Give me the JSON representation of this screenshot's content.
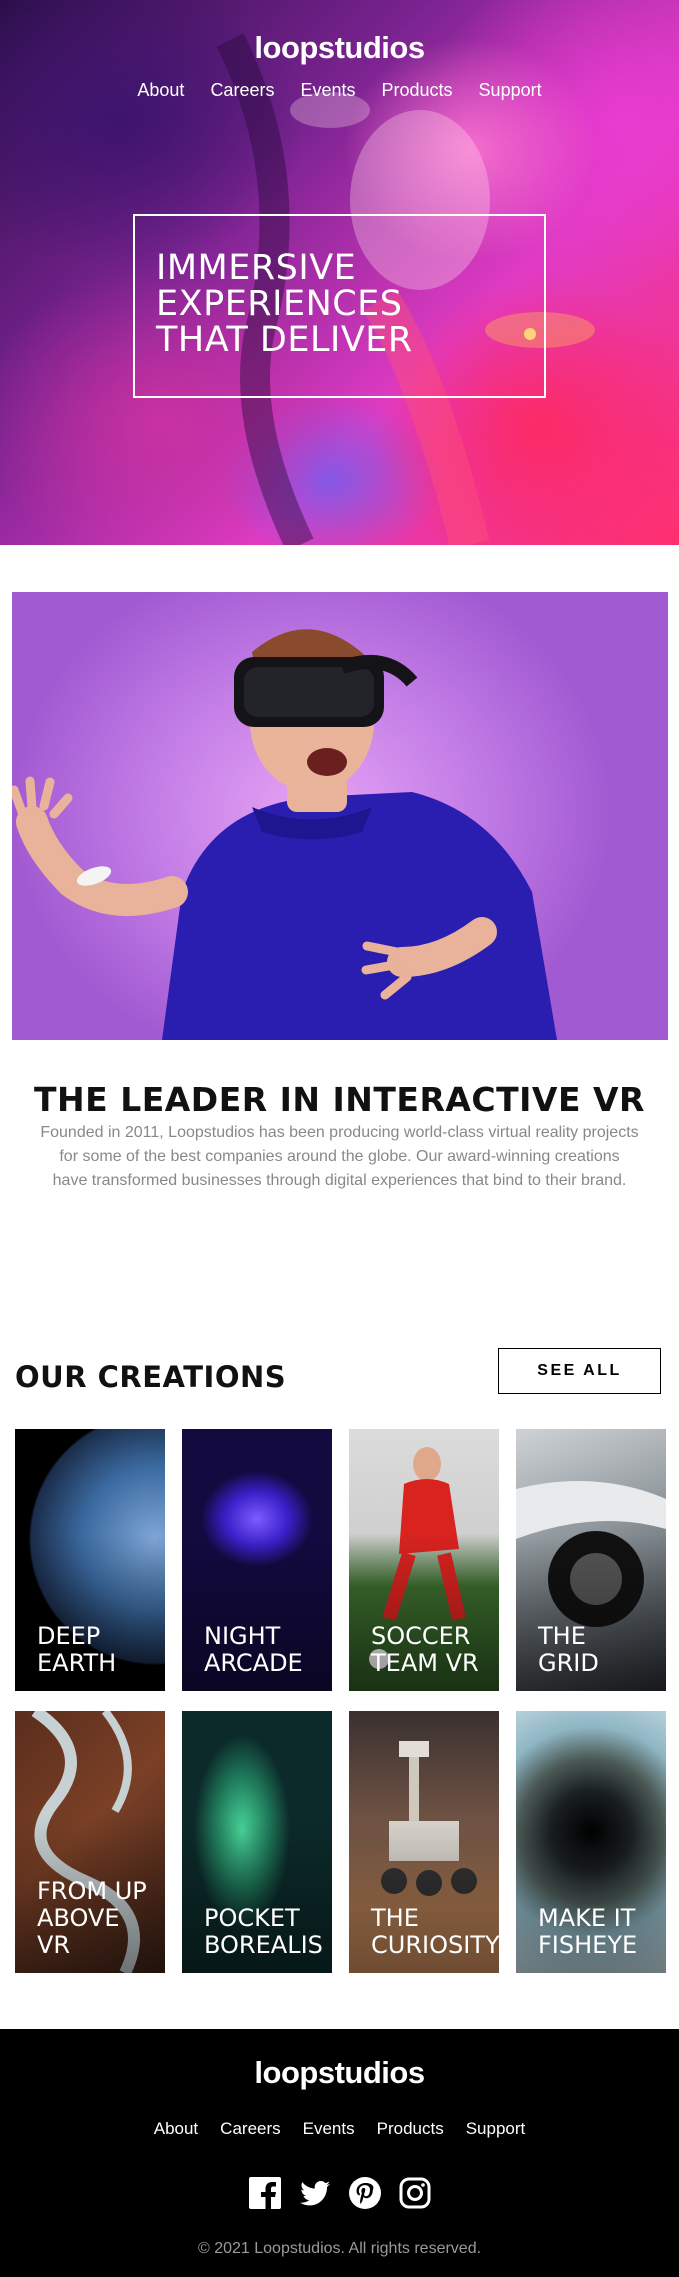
{
  "brand": {
    "name": "loopstudios"
  },
  "nav": [
    "About",
    "Careers",
    "Events",
    "Products",
    "Support"
  ],
  "hero": {
    "title_lines": [
      "IMMERSIVE",
      "EXPERIENCES",
      "THAT DELIVER"
    ]
  },
  "about": {
    "title": "THE LEADER IN INTERACTIVE VR",
    "text": "Founded in 2011, Loopstudios has been producing world-class virtual reality projects for some of the best companies around the globe. Our award-winning creations have transformed businesses through digital experiences that bind to their brand."
  },
  "creations": {
    "title": "OUR CREATIONS",
    "see_all": "SEE ALL",
    "items": [
      "DEEP\nEARTH",
      "NIGHT\nARCADE",
      "SOCCER\nTEAM VR",
      "THE\nGRID",
      "FROM UP\nABOVE\nVR",
      "POCKET\nBOREALIS",
      "THE\nCURIOSITY",
      "MAKE IT\nFISHEYE"
    ]
  },
  "footer": {
    "nav": [
      "About",
      "Careers",
      "Events",
      "Products",
      "Support"
    ],
    "socials": [
      "facebook-icon",
      "twitter-icon",
      "pinterest-icon",
      "instagram-icon"
    ],
    "copyright": "© 2021 Loopstudios. All rights reserved."
  },
  "colors": {
    "accent": "#e03bc3",
    "footer_bg": "#000000",
    "muted_text": "#888888"
  }
}
